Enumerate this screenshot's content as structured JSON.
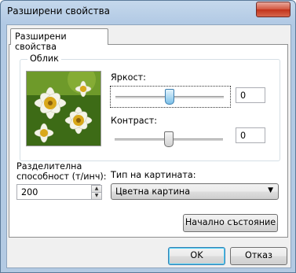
{
  "window": {
    "title": "Разширени свойства",
    "close_glyph": "✕"
  },
  "tab": {
    "label": "Разширени свойства"
  },
  "appearance": {
    "group_label": "Облик",
    "brightness": {
      "label": "Яркост:",
      "value": "0",
      "level": 0.5
    },
    "contrast": {
      "label": "Контраст:",
      "value": "0",
      "level": 0.5
    }
  },
  "resolution": {
    "label_line1": "Разделителна",
    "label_line2": "способност (т/инч):",
    "value": "200"
  },
  "picture_type": {
    "label": "Тип на картината:",
    "selected": "Цветна картина"
  },
  "buttons": {
    "reset": "Начално състояние",
    "ok": "OK",
    "cancel": "Отказ"
  },
  "icons": {
    "spin_up": "▲",
    "spin_down": "▼",
    "dropdown": "▼"
  }
}
